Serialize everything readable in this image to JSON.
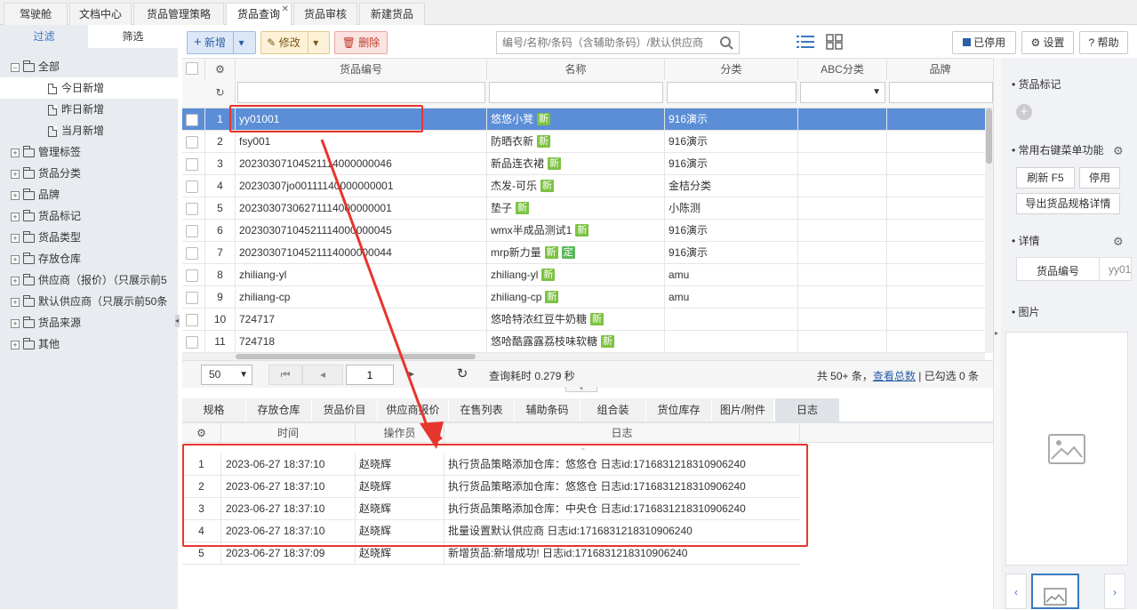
{
  "top_tabs": [
    "驾驶舱",
    "文档中心",
    "货品管理策略",
    "货品查询",
    "货品审核",
    "新建货品"
  ],
  "sidebar": {
    "tabs": [
      "过滤",
      "筛选"
    ],
    "root": "全部",
    "sub_items": [
      "今日新增",
      "昨日新增",
      "当月新增"
    ],
    "groups": [
      "管理标签",
      "货品分类",
      "品牌",
      "货品标记",
      "货品类型",
      "存放仓库",
      "供应商（报价）（只展示前5",
      "默认供应商（只展示前50条",
      "货品来源",
      "其他"
    ]
  },
  "toolbar": {
    "new_label": "新增",
    "edit_label": "修改",
    "delete_label": "删除",
    "search_placeholder": "编号/名称/条码（含辅助条码）/默认供应商",
    "disabled_label": "已停用",
    "settings_label": "设置",
    "help_label": "帮助"
  },
  "grid": {
    "headers": [
      "货品编号",
      "名称",
      "分类",
      "ABC分类",
      "品牌"
    ],
    "rows": [
      {
        "no": "1",
        "code": "yy01001",
        "name": "悠悠小凳",
        "badges": [
          "新"
        ],
        "category": "916演示"
      },
      {
        "no": "2",
        "code": "fsy001",
        "name": "防晒衣新",
        "badges": [
          "新"
        ],
        "category": "916演示"
      },
      {
        "no": "3",
        "code": "20230307104521114000000046",
        "name": "新品连衣裙",
        "badges": [
          "新"
        ],
        "category": "916演示"
      },
      {
        "no": "4",
        "code": "20230307jo00111140000000001",
        "name": "杰发-可乐",
        "badges": [
          "新"
        ],
        "category": "金桔分类"
      },
      {
        "no": "5",
        "code": "20230307306271114000000001",
        "name": "垫子",
        "badges": [
          "新"
        ],
        "category": "小陈测"
      },
      {
        "no": "6",
        "code": "20230307104521114000000045",
        "name": "wmx半成品测试1",
        "badges": [
          "新"
        ],
        "category": "916演示"
      },
      {
        "no": "7",
        "code": "20230307104521114000000044",
        "name": "mrp新力量",
        "badges": [
          "新",
          "定"
        ],
        "category": "916演示"
      },
      {
        "no": "8",
        "code": "zhiliang-yl",
        "name": "zhiliang-yl",
        "badges": [
          "新"
        ],
        "category": "amu"
      },
      {
        "no": "9",
        "code": "zhiliang-cp",
        "name": "zhiliang-cp",
        "badges": [
          "新"
        ],
        "category": "amu"
      },
      {
        "no": "10",
        "code": "724717",
        "name": "悠哈特浓红豆牛奶糖",
        "badges": [
          "新"
        ],
        "category": ""
      },
      {
        "no": "11",
        "code": "724718",
        "name": "悠哈酷露露荔枝味软糖",
        "badges": [
          "新"
        ],
        "category": ""
      }
    ]
  },
  "pager": {
    "page_size": "50",
    "page": "1",
    "query_time": "查询耗时 0.279 秒",
    "total": "共 50+ 条，",
    "view_total": "查看总数",
    "selected": "| 已勾选 0 条"
  },
  "bottom_tabs": [
    "规格",
    "存放仓库",
    "货品价目",
    "供应商报价",
    "在售列表",
    "辅助条码",
    "组合装",
    "货位库存",
    "图片/附件",
    "日志"
  ],
  "log": {
    "headers": [
      "时间",
      "操作员",
      "日志"
    ],
    "rows": [
      {
        "no": "1",
        "time": "2023-06-27 18:37:10",
        "operator": "赵晓辉",
        "text": "执行货品策略添加仓库：悠悠仓 日志id:1716831218310906240"
      },
      {
        "no": "2",
        "time": "2023-06-27 18:37:10",
        "operator": "赵晓辉",
        "text": "执行货品策略添加仓库：悠悠仓 日志id:1716831218310906240"
      },
      {
        "no": "3",
        "time": "2023-06-27 18:37:10",
        "operator": "赵晓辉",
        "text": "执行货品策略添加仓库：中央仓 日志id:1716831218310906240"
      },
      {
        "no": "4",
        "time": "2023-06-27 18:37:10",
        "operator": "赵晓辉",
        "text": "批量设置默认供应商 日志id:1716831218310906240"
      },
      {
        "no": "5",
        "time": "2023-06-27 18:37:09",
        "operator": "赵晓辉",
        "text": "新增货品:新增成功! 日志id:1716831218310906240"
      }
    ]
  },
  "right_panel": {
    "mark_title": "货品标记",
    "menu_title": "常用右键菜单功能",
    "refresh_label": "刷新  F5",
    "disable_label": "停用",
    "export_label": "导出货品规格详情",
    "detail_title": "详情",
    "detail_field": "货品编号",
    "detail_value": "yy01",
    "image_title": "图片"
  },
  "colors": {
    "selected_row": "#5b8ed6",
    "badge_green": "#7cc242",
    "annotation_red": "#e8352c",
    "accent_blue": "#3a78c3"
  }
}
